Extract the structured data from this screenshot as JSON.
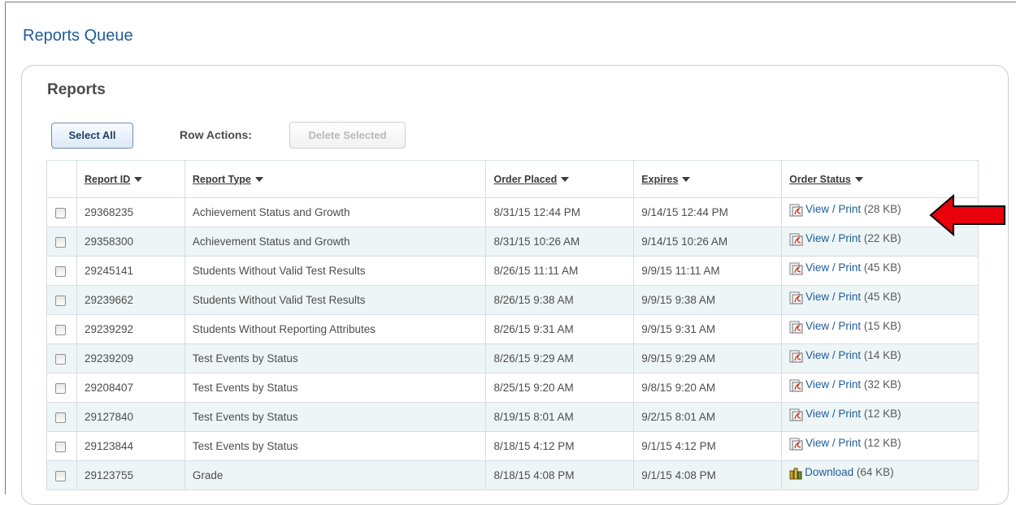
{
  "page": {
    "title": "Reports Queue"
  },
  "panel": {
    "title": "Reports"
  },
  "toolbar": {
    "select_all_label": "Select All",
    "row_actions_label": "Row Actions:",
    "delete_selected_label": "Delete Selected"
  },
  "table": {
    "columns": [
      "Report ID",
      "Report Type",
      "Order Placed",
      "Expires",
      "Order Status"
    ],
    "rows": [
      {
        "id": "29368235",
        "type": "Achievement Status and Growth",
        "placed": "8/31/15 12:44 PM",
        "expires": "9/14/15 12:44 PM",
        "action": "View / Print",
        "size": "(28 KB)",
        "icon": "pdf-icon"
      },
      {
        "id": "29358300",
        "type": "Achievement Status and Growth",
        "placed": "8/31/15 10:26 AM",
        "expires": "9/14/15 10:26 AM",
        "action": "View / Print",
        "size": "(22 KB)",
        "icon": "pdf-icon"
      },
      {
        "id": "29245141",
        "type": "Students Without Valid Test Results",
        "placed": "8/26/15 11:11 AM",
        "expires": "9/9/15 11:11 AM",
        "action": "View / Print",
        "size": "(45 KB)",
        "icon": "pdf-icon"
      },
      {
        "id": "29239662",
        "type": "Students Without Valid Test Results",
        "placed": "8/26/15 9:38 AM",
        "expires": "9/9/15 9:38 AM",
        "action": "View / Print",
        "size": "(45 KB)",
        "icon": "pdf-icon"
      },
      {
        "id": "29239292",
        "type": "Students Without Reporting Attributes",
        "placed": "8/26/15 9:31 AM",
        "expires": "9/9/15 9:31 AM",
        "action": "View / Print",
        "size": "(15 KB)",
        "icon": "pdf-icon"
      },
      {
        "id": "29239209",
        "type": "Test Events by Status",
        "placed": "8/26/15 9:29 AM",
        "expires": "9/9/15 9:29 AM",
        "action": "View / Print",
        "size": "(14 KB)",
        "icon": "pdf-icon"
      },
      {
        "id": "29208407",
        "type": "Test Events by Status",
        "placed": "8/25/15 9:20 AM",
        "expires": "9/8/15 9:20 AM",
        "action": "View / Print",
        "size": "(32 KB)",
        "icon": "pdf-icon"
      },
      {
        "id": "29127840",
        "type": "Test Events by Status",
        "placed": "8/19/15 8:01 AM",
        "expires": "9/2/15 8:01 AM",
        "action": "View / Print",
        "size": "(12 KB)",
        "icon": "pdf-icon"
      },
      {
        "id": "29123844",
        "type": "Test Events by Status",
        "placed": "8/18/15 4:12 PM",
        "expires": "9/1/15 4:12 PM",
        "action": "View / Print",
        "size": "(12 KB)",
        "icon": "pdf-icon"
      },
      {
        "id": "29123755",
        "type": "Grade",
        "placed": "8/18/15 4:08 PM",
        "expires": "9/1/15 4:08 PM",
        "action": "Download",
        "size": "(64 KB)",
        "icon": "download-icon"
      }
    ]
  },
  "colors": {
    "link": "#1f5c99",
    "row_alt": "#eef5f6",
    "annotation_arrow": "#e8000b"
  },
  "annotation": {
    "icon": "red-arrow-icon",
    "points_to_row": 0
  }
}
